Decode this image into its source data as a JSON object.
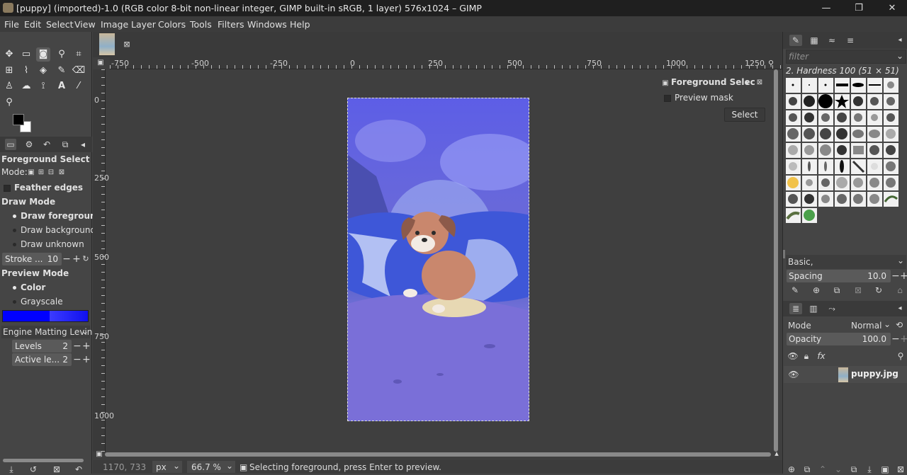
{
  "window": {
    "title": "[puppy] (imported)-1.0 (RGB color 8-bit non-linear integer, GIMP built-in sRGB, 1 layer) 576x1024 – GIMP",
    "minimize": "—",
    "maximize": "❐",
    "close": "✕"
  },
  "menu": [
    "File",
    "Edit",
    "Select",
    "View",
    "Image",
    "Layer",
    "Colors",
    "Tools",
    "Filters",
    "Windows",
    "Help"
  ],
  "tool_options": {
    "title": "Foreground Select",
    "mode_label": "Mode:",
    "feather_edges": "Feather edges",
    "draw_mode_label": "Draw Mode",
    "draw_modes": [
      "Draw foreground",
      "Draw background",
      "Draw unknown"
    ],
    "stroke_label": "Stroke ...",
    "stroke_value": "10",
    "preview_mode_label": "Preview Mode",
    "preview_modes": [
      "Color",
      "Grayscale"
    ],
    "engine_label": "Engine Matting Levin",
    "levels_label": "Levels",
    "levels_value": "2",
    "active_label": "Active le...",
    "active_value": "2"
  },
  "ruler": {
    "h_labels": [
      "-750",
      "-500",
      "-250",
      "0",
      "250",
      "500",
      "750",
      "1000",
      "1250"
    ],
    "v_labels": [
      "0",
      "250",
      "500",
      "750",
      "1000"
    ]
  },
  "fg_select_dialog": {
    "title": "Foreground Selec",
    "preview_mask": "Preview mask",
    "select_button": "Select"
  },
  "brushes": {
    "filter_placeholder": "filter",
    "current": "2. Hardness 100 (51 × 51)",
    "preset": "Basic,",
    "spacing_label": "Spacing",
    "spacing_value": "10.0"
  },
  "layers": {
    "mode_label": "Mode",
    "mode_value": "Normal",
    "opacity_label": "Opacity",
    "opacity_value": "100.0",
    "layer_name": "puppy.jpg"
  },
  "status": {
    "coords": "1170, 733",
    "unit": "px",
    "zoom": "66.7 %",
    "message": "Selecting foreground, press Enter to preview."
  },
  "colors": {
    "fg": "#000000",
    "bg": "#ffffff",
    "accent": "#0000ff"
  }
}
